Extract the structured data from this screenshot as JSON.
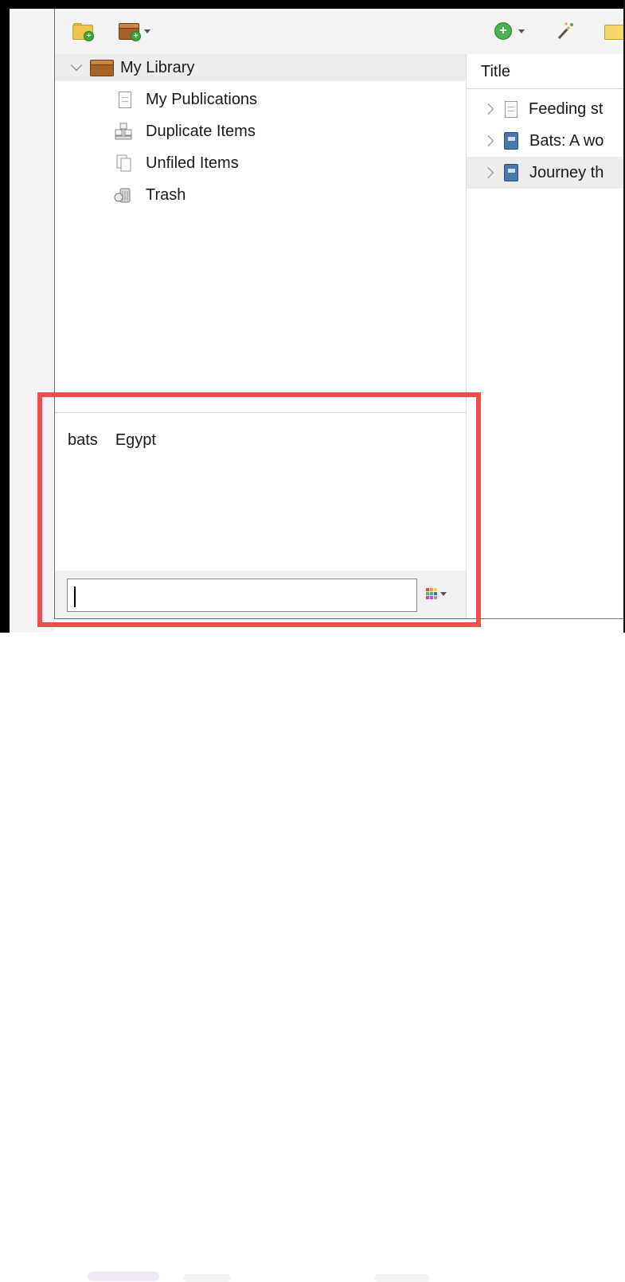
{
  "toolbar": {
    "new_collection_icon": "folder-plus-icon",
    "new_library_icon": "library-plus-icon",
    "new_item_icon": "add-circle-icon",
    "wand_icon": "magic-wand-icon"
  },
  "collections": {
    "items": [
      {
        "label": "My Library",
        "icon": "library-icon",
        "selected": true
      },
      {
        "label": "My Publications",
        "icon": "document-icon"
      },
      {
        "label": "Duplicate Items",
        "icon": "duplicate-items-icon"
      },
      {
        "label": "Unfiled Items",
        "icon": "unfiled-items-icon"
      },
      {
        "label": "Trash",
        "icon": "trash-icon"
      }
    ]
  },
  "tags": {
    "items": [
      "bats",
      "Egypt"
    ],
    "filter_value": ""
  },
  "items_pane": {
    "column_title": "Title",
    "rows": [
      {
        "title": "Feeding st",
        "icon": "document-icon"
      },
      {
        "title": "Bats: A wo",
        "icon": "book-icon"
      },
      {
        "title": "Journey th",
        "icon": "book-icon",
        "selected": true
      }
    ]
  },
  "colors": {
    "highlight": "#f04d4d",
    "selection": "#ececec"
  }
}
